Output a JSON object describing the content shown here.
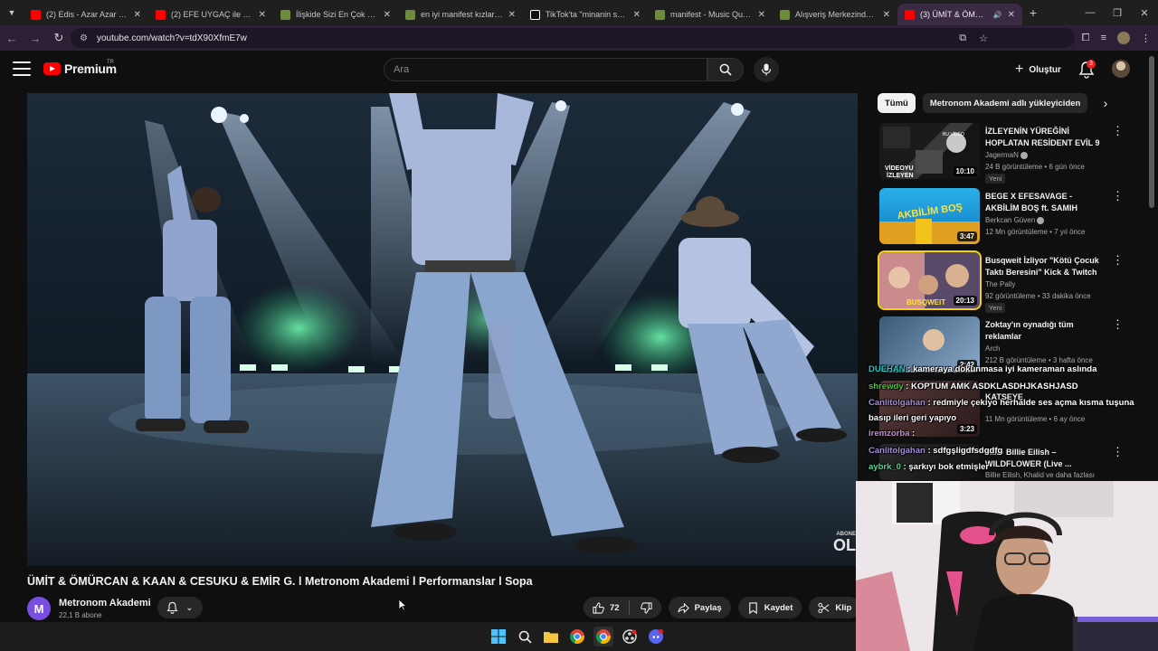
{
  "browser": {
    "tabs": [
      {
        "title": "(2) Edis - Azar Azar (Offic",
        "icon_color": "#ff0000"
      },
      {
        "title": "(2) EFE UYGAÇ ile SINIRSI",
        "icon_color": "#ff0000"
      },
      {
        "title": "İlişkide Sizi En Çok Rahatsı",
        "icon_color": "#6e8b3d"
      },
      {
        "title": "en iyi manifest kızları tiktok",
        "icon_color": "#6e8b3d"
      },
      {
        "title": "TikTok'ta \"minanin sevgilis",
        "icon_color": "#ffffff"
      },
      {
        "title": "manifest - Music Quiz - Ci",
        "icon_color": "#6e8b3d"
      },
      {
        "title": "Alışveriş Merkezinde Han",
        "icon_color": "#6e8b3d"
      },
      {
        "title": "(3) ÜMİT & ÖMÜRCAN",
        "icon_color": "#ff0000",
        "active": true
      }
    ],
    "url": "youtube.com/watch?v=tdX90XfmE7w",
    "accent": "#3a2a44"
  },
  "header": {
    "logo_text": "Premium",
    "logo_region": "TR",
    "search_placeholder": "Ara",
    "create_label": "Oluştur",
    "notification_count": "3"
  },
  "video": {
    "title": "ÜMİT & ÖMÜRCAN & KAAN & CESUKU & EMİR G. l Metronom Akademi l Performanslar l Sopa",
    "watermark_small": "ABONE",
    "watermark_large": "OL",
    "channel": {
      "avatar_letter": "M",
      "name": "Metronom Akademi",
      "subscribers": "22,1 B abone"
    },
    "actions": {
      "likes": "72",
      "share": "Paylaş",
      "save": "Kaydet",
      "clip": "Klip"
    }
  },
  "sidebar": {
    "chips": [
      "Tümü",
      "Metronom Akademi adlı yükleyiciden"
    ],
    "recommendations": [
      {
        "title": "İZLEYENİN YÜREĞİNİ HOPLATAN RESİDENT EVİL 9 ...",
        "channel": "JagermaN",
        "verified": true,
        "meta": "24 B görüntüleme • 6 gün önce",
        "badge": "Yeni",
        "duration": "10:10"
      },
      {
        "title": "BEGE X EFESAVAGE -AKBİLİM BOŞ ft. SAMIH",
        "channel": "Berkcan Güven",
        "verified": true,
        "meta": "12 Mn görüntüleme • 7 yıl önce",
        "badge": "",
        "duration": "3:47"
      },
      {
        "title": "Busqweit İzliyor \"Kötü Çocuk Taktı Beresini\" Kick & Twitch ...",
        "channel": "The Pally",
        "verified": false,
        "meta": "92 görüntüleme • 33 dakika önce",
        "badge": "Yeni",
        "duration": "20:13"
      },
      {
        "title": "Zoktay'ın oynadığı tüm reklamlar",
        "channel": "Arch",
        "verified": false,
        "meta": "212 B görüntüleme • 3 hafta önce",
        "badge": "",
        "duration": "2:42"
      },
      {
        "title": "KATSEYE",
        "channel": "",
        "verified": false,
        "meta": "11 Mn görüntüleme • 6 ay önce",
        "badge": "",
        "duration": "3:23"
      },
      {
        "title": "Mix - Billie Eilish – WILDFLOWER (Live ...",
        "channel": "Billie Eilish, Khalid ve daha fazlası",
        "verified": false,
        "meta": "",
        "badge": "",
        "duration": ""
      }
    ]
  },
  "chat": [
    {
      "user": "DUEHAN",
      "color": "#1fc8c8",
      "message": "kameraya dokunmasa iyi kameraman aslında"
    },
    {
      "user": "shrewdy",
      "color": "#49c43f",
      "message": "KOPTUM AMK ASDKLASDHJKASHJASD"
    },
    {
      "user": "Canlitolgahan",
      "color": "#a58de0",
      "message": "redmiyle çekiyo herhalde ses açma kısma tuşuna basıp ileri geri yapıyo"
    },
    {
      "user": "iremzorba",
      "color": "#c78ae0",
      "message": ""
    },
    {
      "user": "Canlitolgahan",
      "color": "#a58de0",
      "message": "sdfgşligdfsdgdfg"
    },
    {
      "user": "aybrk_0",
      "color": "#56d49a",
      "message": "şarkıyı bok etmişler"
    }
  ]
}
